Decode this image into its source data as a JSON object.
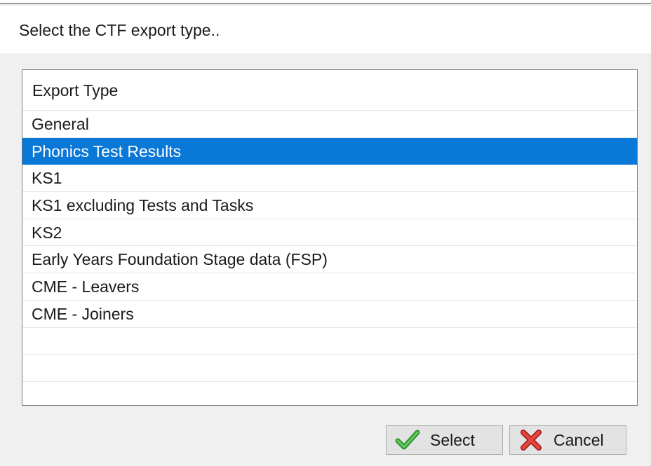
{
  "dialog": {
    "prompt": "Select the CTF export type.."
  },
  "list": {
    "header": "Export Type",
    "items": [
      {
        "label": "General"
      },
      {
        "label": "Phonics Test Results"
      },
      {
        "label": "KS1"
      },
      {
        "label": "KS1 excluding Tests and Tasks"
      },
      {
        "label": "KS2"
      },
      {
        "label": "Early Years Foundation Stage data (FSP)"
      },
      {
        "label": "CME - Leavers"
      },
      {
        "label": "CME - Joiners"
      }
    ],
    "selected_label": "Phonics Test Results"
  },
  "buttons": {
    "select_label": "Select",
    "select_icon": "checkmark-icon",
    "cancel_label": "Cancel",
    "cancel_icon": "red-x-icon"
  },
  "colors": {
    "selection": "#0a78d7",
    "check_green": "#3aa63a",
    "cancel_red": "#d9302c"
  }
}
